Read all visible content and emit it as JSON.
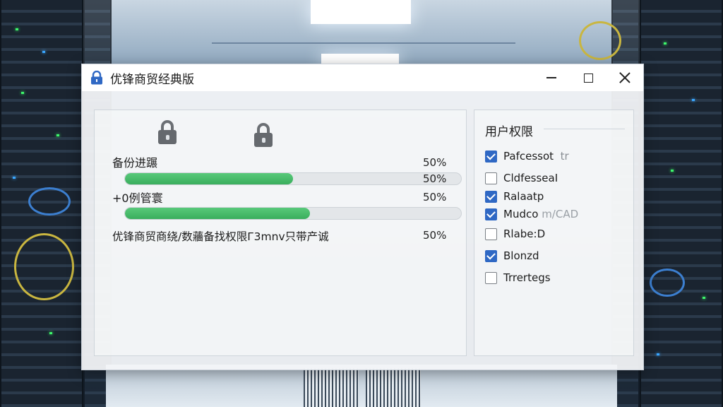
{
  "window": {
    "title": "优锋商贸经典版"
  },
  "backup": {
    "rows": [
      {
        "label": "备份进蹍",
        "percent_text": "50%",
        "bar_percent_text": "50%",
        "progress": 0.5
      },
      {
        "label": "+0例管寰",
        "percent_text": "50%",
        "progress": 0.55
      },
      {
        "label": "优锋商贸商绕/数蘠备找权限Г3mnv只带产诚",
        "percent_text": "50%"
      }
    ]
  },
  "permissions": {
    "title": "用户权限",
    "items": [
      {
        "label": "Pafcessot",
        "suffix": "tr",
        "checked": true
      },
      {
        "label": "Cldfessea",
        "suffix": "I",
        "checked": false
      },
      {
        "label": "Ralaatp",
        "suffix": "",
        "checked": true
      },
      {
        "label": "Mudco",
        "suffix": "m/CAD",
        "checked": true
      },
      {
        "label": "Rlabe:D",
        "suffix": "",
        "checked": false
      },
      {
        "label": "Blonzd",
        "suffix": "",
        "checked": true
      },
      {
        "label": "Trrertegs",
        "suffix": "",
        "checked": false
      }
    ]
  },
  "colors": {
    "progress_fill": "#3aae5d",
    "checkbox_checked": "#2f68c4",
    "lock_icon": "#2f68c4"
  },
  "icons": {
    "title": "lock-icon",
    "decorative": [
      "lock-icon",
      "lock-icon"
    ]
  }
}
